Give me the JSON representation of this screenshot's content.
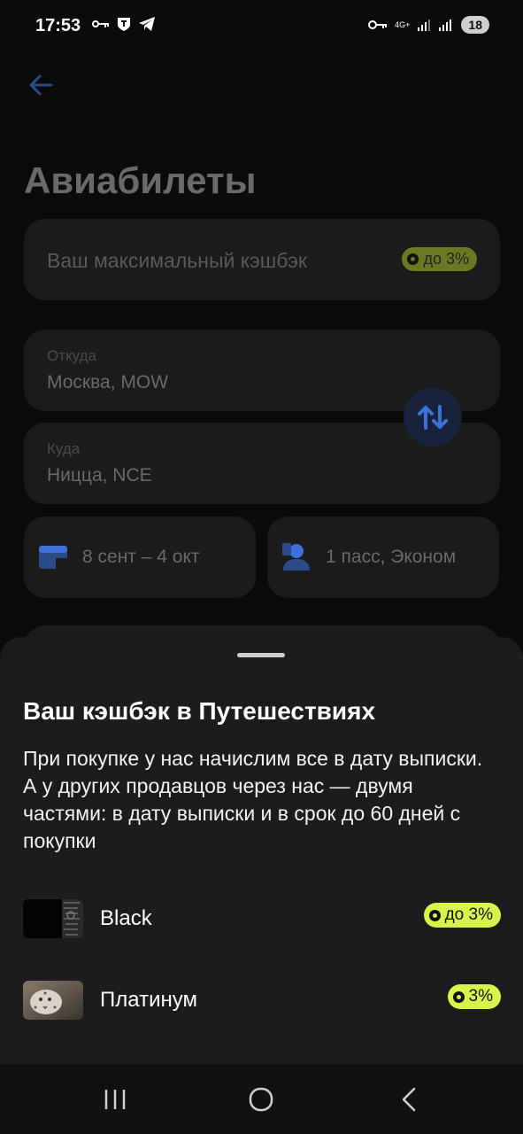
{
  "status": {
    "time": "17:53",
    "left_icons": [
      "key-icon",
      "shield-icon",
      "telegram-icon"
    ],
    "right_icons": [
      "vpn-key-icon",
      "network-4g-icon",
      "signal-icon",
      "signal-r-icon"
    ],
    "network": "4G+",
    "battery": "18"
  },
  "header": {
    "back_icon": "arrow-left-icon",
    "title": "Авиабилеты"
  },
  "cashback_card": {
    "text": "Ваш максимальный кэшбэк",
    "badge": "до 3%"
  },
  "search": {
    "from_label": "Откуда",
    "from_value": "Москва, MOW",
    "to_label": "Куда",
    "to_value": "Ницца, NCE",
    "swap_icon": "swap-arrows-icon",
    "dates": "8 сент – 4 окт",
    "passengers": "1 пасс, Эконом"
  },
  "sheet": {
    "title": "Ваш кэшбэк в Путешествиях",
    "description": "При покупке у нас начислим все в дату выписки. А у других продавцов через нас — двумя частями: в дату выписки и в срок до 60 дней с покупки",
    "tiers": [
      {
        "name": "Black",
        "badge": "до 3%"
      },
      {
        "name": "Платинум",
        "badge": "3%"
      }
    ]
  },
  "colors": {
    "accent_lime": "#d8f34a",
    "accent_blue": "#3f6fd8",
    "sheet_bg": "#1c1c1e"
  },
  "navbar": {
    "icons": [
      "recent-apps-icon",
      "home-icon",
      "back-icon"
    ]
  }
}
